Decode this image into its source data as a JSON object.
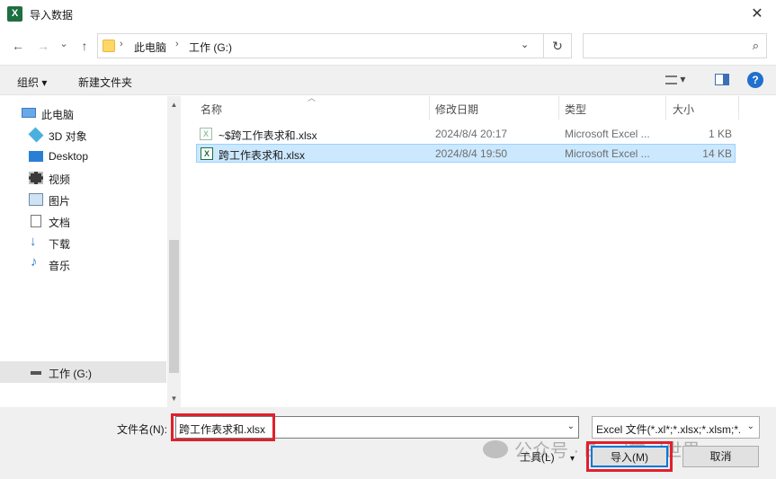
{
  "window": {
    "title": "导入数据",
    "close": "✕",
    "app_icon_letter": "X"
  },
  "nav": {
    "back": "←",
    "forward": "→",
    "recent": "⌄",
    "up": "↑"
  },
  "address": {
    "crumbs": [
      "此电脑",
      "工作 (G:)"
    ],
    "sep": "›",
    "dropdown": "⌄",
    "refresh": "↻"
  },
  "search": {
    "placeholder": "",
    "icon": "⌕"
  },
  "toolbar": {
    "organize": "组织 ▾",
    "new_folder": "新建文件夹",
    "view_menu": "▾"
  },
  "sidebar": {
    "items": [
      {
        "label": "此电脑",
        "icon": "this-pc"
      },
      {
        "label": "3D 对象",
        "icon": "3d-objects"
      },
      {
        "label": "Desktop",
        "icon": "desktop"
      },
      {
        "label": "视频",
        "icon": "videos"
      },
      {
        "label": "图片",
        "icon": "pictures"
      },
      {
        "label": "文档",
        "icon": "documents"
      },
      {
        "label": "下载",
        "icon": "downloads"
      },
      {
        "label": "音乐",
        "icon": "music"
      },
      {
        "label": "工作 (G:)",
        "icon": "drive"
      }
    ]
  },
  "columns": {
    "name": "名称",
    "modified": "修改日期",
    "type": "类型",
    "size": "大小"
  },
  "files": [
    {
      "name": "~$跨工作表求和.xlsx",
      "modified": "2024/8/4 20:17",
      "type": "Microsoft Excel ...",
      "size": "1 KB"
    },
    {
      "name": "跨工作表求和.xlsx",
      "modified": "2024/8/4 19:50",
      "type": "Microsoft Excel ...",
      "size": "14 KB"
    }
  ],
  "bottom": {
    "filename_label": "文件名(N):",
    "filename_value": "跨工作表求和.xlsx",
    "filetype_value": "Excel 文件(*.xl*;*.xlsx;*.xlsm;*.",
    "tools": "工具(L)",
    "tools_dd": "▾",
    "import": "导入(M)",
    "cancel": "取消"
  },
  "watermark": "公众号 · Excel学习世界",
  "colors": {
    "selection": "#cce8ff",
    "highlight_box": "#e0202e",
    "accent": "#0078d7"
  }
}
